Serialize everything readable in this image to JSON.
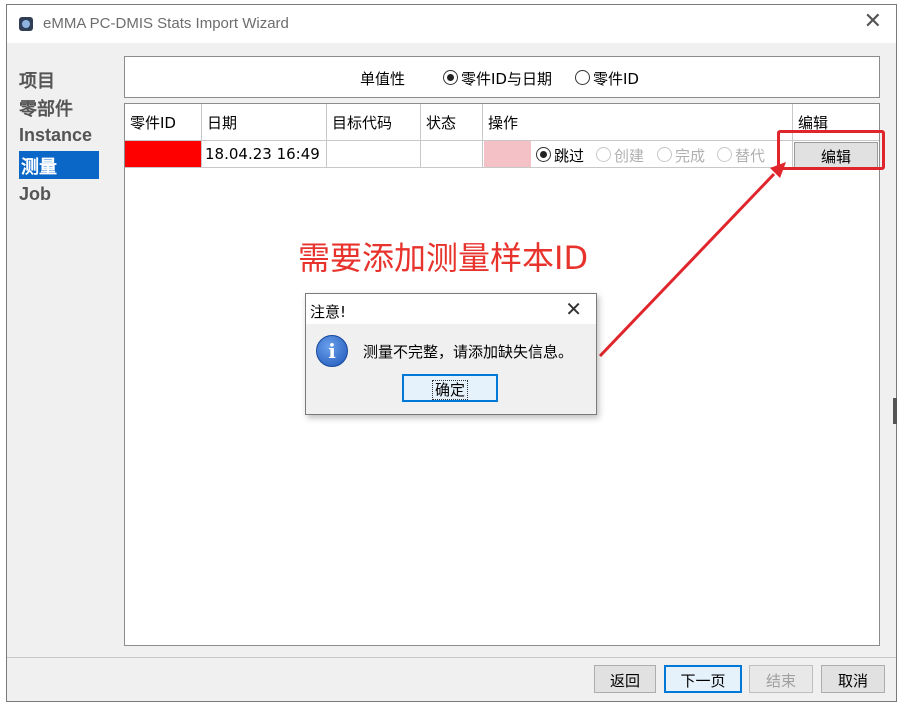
{
  "window": {
    "title": "eMMA PC-DMIS Stats Import Wizard"
  },
  "nav": {
    "items": [
      "项目",
      "零部件",
      "Instance",
      "测量",
      "Job"
    ],
    "active_index": 3
  },
  "filter": {
    "label": "单值性",
    "options": [
      {
        "label": "零件ID与日期",
        "checked": true
      },
      {
        "label": "零件ID",
        "checked": false
      }
    ]
  },
  "table": {
    "columns": [
      "零件ID",
      "日期",
      "目标代码",
      "状态",
      "操作",
      "编辑"
    ],
    "rows": [
      {
        "part_id": "",
        "date": "18.04.23 16:49",
        "target_code": "",
        "status": "",
        "operations": [
          {
            "label": "跳过",
            "checked": true,
            "enabled": true
          },
          {
            "label": "创建",
            "checked": false,
            "enabled": false
          },
          {
            "label": "完成",
            "checked": false,
            "enabled": false
          },
          {
            "label": "替代",
            "checked": false,
            "enabled": false
          }
        ],
        "edit_label": "编辑"
      }
    ]
  },
  "annotation": {
    "text": "需要添加测量样本ID",
    "color": "#e8332c"
  },
  "dialog": {
    "title": "注意!",
    "message": "测量不完整，请添加缺失信息。",
    "ok_label": "确定",
    "icon": "info-icon"
  },
  "footer": {
    "back_label": "返回",
    "next_label": "下一页",
    "finish_label": "结束",
    "cancel_label": "取消"
  },
  "colors": {
    "accent": "#0a67c8",
    "missing_cell": "#ff0000",
    "highlight": "#e0262c"
  }
}
